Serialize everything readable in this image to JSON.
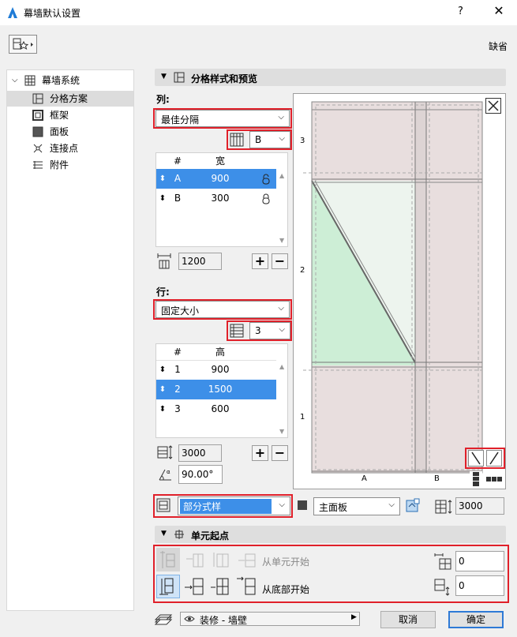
{
  "window": {
    "title": "幕墙默认设置",
    "help": "?",
    "close": "✕"
  },
  "header": {
    "default_label": "缺省"
  },
  "tree": {
    "root": "幕墙系统",
    "items": [
      "分格方案",
      "框架",
      "面板",
      "连接点",
      "附件"
    ]
  },
  "scheme_section": {
    "title": "分格样式和预览"
  },
  "columns": {
    "label": "列:",
    "pattern": "最佳分隔",
    "selector_value": "B",
    "headers": [
      "#",
      "宽"
    ],
    "rows": [
      {
        "id": "A",
        "value": "900",
        "locked": false
      },
      {
        "id": "B",
        "value": "300",
        "locked": true
      }
    ],
    "total": "1200"
  },
  "rows_panel": {
    "label": "行:",
    "pattern": "固定大小",
    "selector_value": "3",
    "headers": [
      "#",
      "高"
    ],
    "rows": [
      {
        "id": "1",
        "value": "900"
      },
      {
        "id": "2",
        "value": "1500"
      },
      {
        "id": "3",
        "value": "600"
      }
    ],
    "total": "3000",
    "angle": "90.00°"
  },
  "preview": {
    "row_labels": [
      "3",
      "2",
      "1"
    ],
    "col_labels": [
      "A",
      "B"
    ]
  },
  "panel_row": {
    "pattern": "部分式样",
    "panel": "主面板",
    "height": "3000"
  },
  "origin_section": {
    "title": "单元起点",
    "from_cell_label": "从单元开始",
    "from_cell_value": "0",
    "from_bottom_label": "从底部开始",
    "from_bottom_value": "0"
  },
  "footer": {
    "layer": "装修 - 墙壁",
    "cancel": "取消",
    "ok": "确定"
  }
}
